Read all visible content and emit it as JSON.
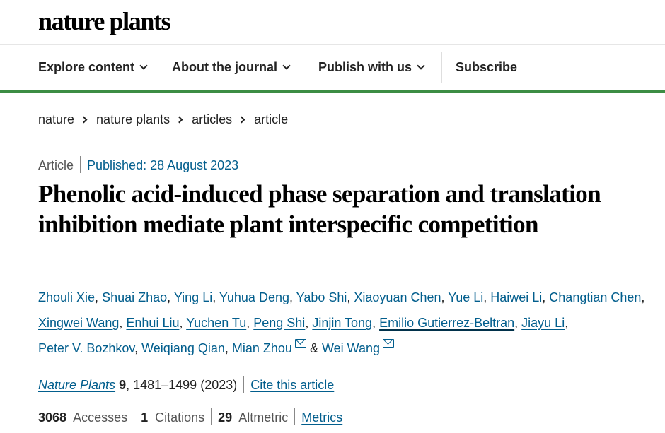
{
  "header": {
    "logo": "nature plants"
  },
  "nav": {
    "items": [
      {
        "label": "Explore content"
      },
      {
        "label": "About the journal"
      },
      {
        "label": "Publish with us"
      }
    ],
    "subscribe": "Subscribe"
  },
  "breadcrumb": [
    "nature",
    "nature plants",
    "articles",
    "article"
  ],
  "article": {
    "type": "Article",
    "published": "Published: 28 August 2023",
    "title": "Phenolic acid-induced phase separation and translation inhibition mediate plant interspecific competition",
    "authors": [
      "Zhouli Xie",
      "Shuai Zhao",
      "Ying Li",
      "Yuhua Deng",
      "Yabo Shi",
      "Xiaoyuan Chen",
      "Yue Li",
      "Haiwei Li",
      "Changtian Chen",
      "Xingwei Wang",
      "Enhui Liu",
      "Yuchen Tu",
      "Peng Shi",
      "Jinjin Tong",
      "Emilio Gutierrez-Beltran",
      "Jiayu Li",
      "Peter V. Bozhkov",
      "Weiqiang Qian",
      "Mian Zhou",
      "Wei Wang"
    ],
    "author_amp": "&",
    "citation": {
      "journal": "Nature Plants",
      "volume": "9",
      "pages_year": ", 1481–1499 (2023)",
      "cite_link": "Cite this article"
    },
    "metrics": {
      "accesses_count": "3068",
      "accesses_label": "Accesses",
      "citations_count": "1",
      "citations_label": "Citations",
      "altmetric_count": "29",
      "altmetric_label": "Altmetric",
      "metrics_link": "Metrics"
    }
  },
  "icons": {
    "nav_chevron": "chevron-down-icon",
    "crumb_separator": "chevron-right-icon",
    "email": "envelope-icon"
  },
  "colors": {
    "link": "#025e8d",
    "accent_rule": "#3c8d44",
    "title": "#000000"
  }
}
